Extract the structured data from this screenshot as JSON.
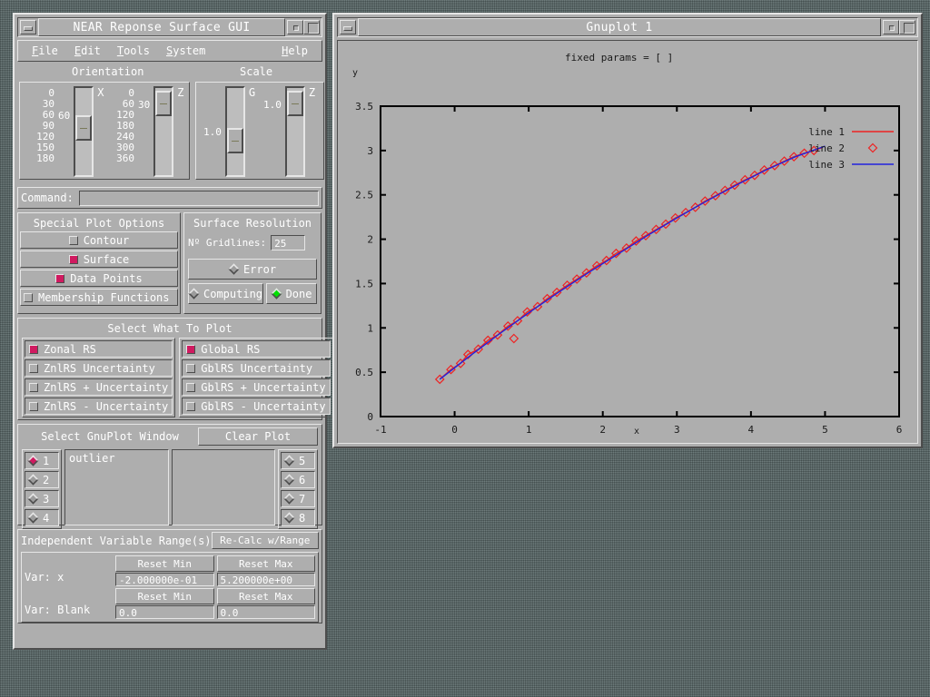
{
  "desktop": {
    "background_color": "#5f6f6f"
  },
  "gui_window": {
    "title": "NEAR Reponse Surface GUI",
    "minimize_icon": "minimize-icon",
    "maximize_icon": "maximize-icon",
    "menu": [
      {
        "label": "File",
        "mnemonic": "F"
      },
      {
        "label": "Edit",
        "mnemonic": "E"
      },
      {
        "label": "Tools",
        "mnemonic": "T"
      },
      {
        "label": "System",
        "mnemonic": "S"
      },
      {
        "label": "Help",
        "mnemonic": "H"
      }
    ],
    "orientation": {
      "title": "Orientation",
      "sliders": [
        {
          "axis": "X",
          "value": "60",
          "ticks": [
            "0",
            "30",
            "60",
            "90",
            "120",
            "150",
            "180"
          ],
          "thumb_pct": 33
        },
        {
          "axis": "Z",
          "value": "30",
          "ticks": [
            "0",
            "60",
            "120",
            "180",
            "240",
            "300",
            "360"
          ],
          "thumb_pct": 8
        }
      ]
    },
    "scale": {
      "title": "Scale",
      "sliders": [
        {
          "axis": "G",
          "value": "1.0",
          "thumb_pct": 48
        },
        {
          "axis": "Z",
          "value": "1.0",
          "thumb_pct": 8
        }
      ]
    },
    "command": {
      "label": "Command:",
      "value": "",
      "placeholder": ""
    },
    "special_plot_options": {
      "title": "Special Plot Options",
      "items": [
        {
          "label": "Contour",
          "checked": false
        },
        {
          "label": "Surface",
          "checked": true
        },
        {
          "label": "Data Points",
          "checked": true
        },
        {
          "label": "Membership Functions",
          "checked": false
        }
      ]
    },
    "surface_resolution": {
      "title": "Surface Resolution",
      "gridlines_label": "Nº Gridlines:",
      "gridlines_value": "25",
      "error_label": "Error",
      "error_on": false,
      "computing_label": "Computing",
      "computing_on": false,
      "done_label": "Done",
      "done_on": true
    },
    "select_what_to_plot": {
      "title": "Select What To Plot",
      "left": [
        {
          "label": "Zonal RS",
          "checked": true
        },
        {
          "label": "ZnlRS Uncertainty",
          "checked": false
        },
        {
          "label": "ZnlRS + Uncertainty",
          "checked": false
        },
        {
          "label": "ZnlRS - Uncertainty",
          "checked": false
        }
      ],
      "right": [
        {
          "label": "Global RS",
          "checked": true
        },
        {
          "label": "GblRS Uncertainty",
          "checked": false
        },
        {
          "label": "GblRS + Uncertainty",
          "checked": false
        },
        {
          "label": "GblRS - Uncertainty",
          "checked": false
        }
      ]
    },
    "gnuplot_window_select": {
      "title": "Select GnuPlot Window",
      "clear_plot_label": "Clear Plot",
      "left_radios": [
        {
          "label": "1",
          "selected": true
        },
        {
          "label": "2",
          "selected": false
        },
        {
          "label": "3",
          "selected": false
        },
        {
          "label": "4",
          "selected": false
        }
      ],
      "right_radios": [
        {
          "label": "5",
          "selected": false
        },
        {
          "label": "6",
          "selected": false
        },
        {
          "label": "7",
          "selected": false
        },
        {
          "label": "8",
          "selected": false
        }
      ],
      "list_left_text": "outlier",
      "list_right_text": ""
    },
    "independent_ranges": {
      "title": "Independent Variable Range(s)",
      "recalc_label": "Re-Calc w/Range",
      "rows": [
        {
          "var_label": "Var: x",
          "reset_min_label": "Reset Min",
          "reset_max_label": "Reset Max",
          "min_value": "-2.000000e-01",
          "max_value": "5.200000e+00"
        },
        {
          "var_label": "Var: Blank",
          "reset_min_label": "Reset Min",
          "reset_max_label": "Reset Max",
          "min_value": "0.0",
          "max_value": "0.0"
        }
      ]
    }
  },
  "gnuplot_window": {
    "title": "Gnuplot 1",
    "minimize_icon": "minimize-icon",
    "maximize_icon": "maximize-icon"
  },
  "chart_data": {
    "type": "scatter",
    "title": "fixed params = [ ]",
    "xlabel": "x",
    "ylabel": "y",
    "xlim": [
      -1,
      6
    ],
    "ylim": [
      0,
      3.5
    ],
    "xticks": [
      -1,
      0,
      1,
      2,
      3,
      4,
      5,
      6
    ],
    "yticks": [
      0,
      0.5,
      1,
      1.5,
      2,
      2.5,
      3,
      3.5
    ],
    "grid": false,
    "legend_position": "top-right",
    "legend": [
      {
        "name": "line 1",
        "style": "line",
        "color": "#ee2222"
      },
      {
        "name": "line 2",
        "style": "marker",
        "marker": "diamond",
        "color": "#ee2222"
      },
      {
        "name": "line 3",
        "style": "line",
        "color": "#2222dd"
      }
    ],
    "series": [
      {
        "name": "line 1",
        "style": "line",
        "color": "#ee2222",
        "points": [
          [
            -0.2,
            0.42
          ],
          [
            -0.05,
            0.53
          ],
          [
            0.08,
            0.6
          ],
          [
            0.18,
            0.7
          ],
          [
            0.32,
            0.76
          ],
          [
            0.45,
            0.86
          ],
          [
            0.58,
            0.92
          ],
          [
            0.72,
            1.02
          ],
          [
            0.85,
            1.08
          ],
          [
            0.98,
            1.18
          ],
          [
            1.12,
            1.24
          ],
          [
            1.25,
            1.33
          ],
          [
            1.38,
            1.4
          ],
          [
            1.52,
            1.48
          ],
          [
            1.65,
            1.55
          ],
          [
            1.78,
            1.62
          ],
          [
            1.92,
            1.7
          ],
          [
            2.05,
            1.76
          ],
          [
            2.18,
            1.84
          ],
          [
            2.32,
            1.9
          ],
          [
            2.45,
            1.98
          ],
          [
            2.58,
            2.04
          ],
          [
            2.72,
            2.11
          ],
          [
            2.85,
            2.17
          ],
          [
            2.98,
            2.24
          ],
          [
            3.12,
            2.3
          ],
          [
            3.25,
            2.36
          ],
          [
            3.38,
            2.43
          ],
          [
            3.52,
            2.49
          ],
          [
            3.65,
            2.55
          ],
          [
            3.78,
            2.61
          ],
          [
            3.92,
            2.67
          ],
          [
            4.05,
            2.72
          ],
          [
            4.18,
            2.78
          ],
          [
            4.32,
            2.83
          ],
          [
            4.45,
            2.88
          ],
          [
            4.58,
            2.93
          ],
          [
            4.72,
            2.97
          ],
          [
            4.85,
            3.0
          ],
          [
            4.95,
            3.03
          ]
        ]
      },
      {
        "name": "line 2",
        "style": "marker",
        "marker": "diamond",
        "color": "#ee2222",
        "points": [
          [
            -0.2,
            0.42
          ],
          [
            -0.05,
            0.53
          ],
          [
            0.08,
            0.6
          ],
          [
            0.18,
            0.7
          ],
          [
            0.32,
            0.76
          ],
          [
            0.45,
            0.86
          ],
          [
            0.58,
            0.92
          ],
          [
            0.72,
            1.02
          ],
          [
            0.8,
            0.88
          ],
          [
            0.85,
            1.08
          ],
          [
            0.98,
            1.18
          ],
          [
            1.12,
            1.24
          ],
          [
            1.25,
            1.33
          ],
          [
            1.38,
            1.4
          ],
          [
            1.52,
            1.48
          ],
          [
            1.65,
            1.55
          ],
          [
            1.78,
            1.62
          ],
          [
            1.92,
            1.7
          ],
          [
            2.05,
            1.76
          ],
          [
            2.18,
            1.84
          ],
          [
            2.32,
            1.9
          ],
          [
            2.45,
            1.98
          ],
          [
            2.58,
            2.04
          ],
          [
            2.72,
            2.11
          ],
          [
            2.85,
            2.17
          ],
          [
            2.98,
            2.24
          ],
          [
            3.12,
            2.3
          ],
          [
            3.25,
            2.36
          ],
          [
            3.38,
            2.43
          ],
          [
            3.52,
            2.49
          ],
          [
            3.65,
            2.55
          ],
          [
            3.78,
            2.61
          ],
          [
            3.92,
            2.67
          ],
          [
            4.05,
            2.72
          ],
          [
            4.18,
            2.78
          ],
          [
            4.32,
            2.83
          ],
          [
            4.45,
            2.88
          ],
          [
            4.58,
            2.93
          ],
          [
            4.72,
            2.97
          ],
          [
            4.85,
            3.0
          ]
        ]
      },
      {
        "name": "line 3",
        "style": "line",
        "color": "#2222dd",
        "points": [
          [
            -0.2,
            0.42
          ],
          [
            0.2,
            0.68
          ],
          [
            0.6,
            0.93
          ],
          [
            1.0,
            1.17
          ],
          [
            1.4,
            1.4
          ],
          [
            1.8,
            1.62
          ],
          [
            2.2,
            1.83
          ],
          [
            2.6,
            2.04
          ],
          [
            3.0,
            2.24
          ],
          [
            3.4,
            2.43
          ],
          [
            3.8,
            2.61
          ],
          [
            4.2,
            2.78
          ],
          [
            4.6,
            2.93
          ],
          [
            5.0,
            3.05
          ]
        ]
      }
    ]
  }
}
